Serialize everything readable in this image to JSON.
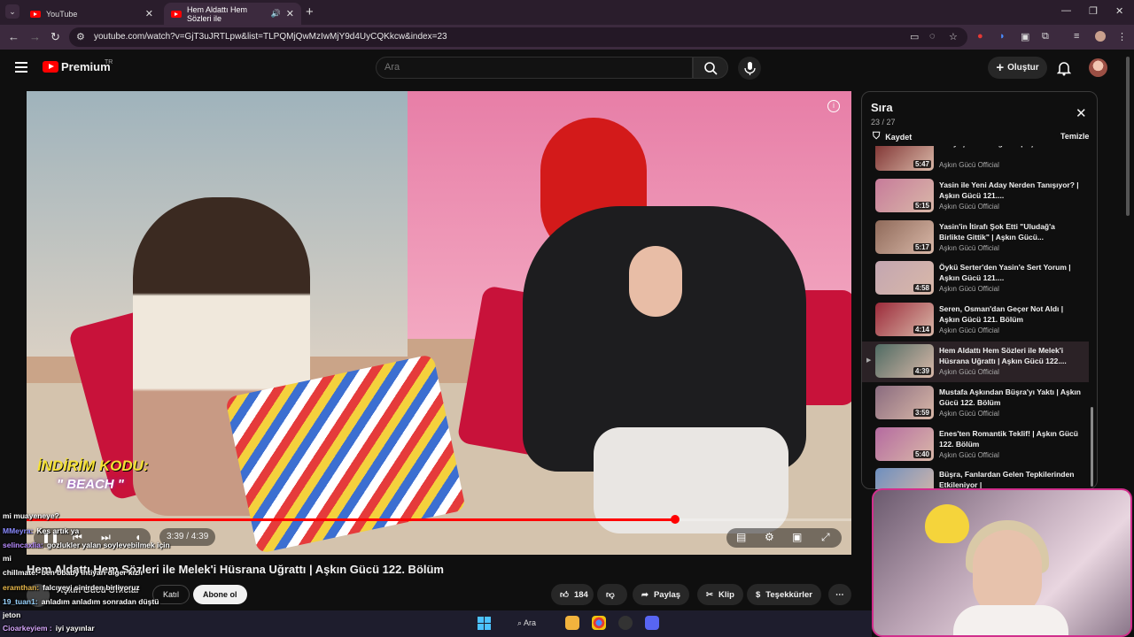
{
  "browser": {
    "tabs": [
      {
        "label": "YouTube"
      },
      {
        "label": "Hem Aldattı Hem Sözleri ile"
      }
    ],
    "url": "youtube.com/watch?v=GjT3uJRTLpw&list=TLPQMjQwMzIwMjY9d4UyCQKkcw&index=23"
  },
  "header": {
    "logo_text": "Premium",
    "logo_suffix": "TR",
    "search_placeholder": "Ara",
    "create_label": "Oluştur"
  },
  "video": {
    "title": "Hem Aldattı Hem Sözleri ile Melek'i Hüsrana Uğrattı | Aşkın Gücü 122. Bölüm",
    "time": "3:39 / 4:39",
    "progress_fraction": 0.786,
    "promo_label": "İNDİRİM KODU:",
    "promo_code": "\" BEACH \"",
    "channel": "Aşkın Gücü Official",
    "join_label": "Katıl",
    "subscribe_label": "Abone ol",
    "likes": "184",
    "share_label": "Paylaş",
    "clip_label": "Klip",
    "thanks_label": "Teşekkürler"
  },
  "playlist": {
    "title": "Sıra",
    "count": "23 / 27",
    "save_label": "Kaydet",
    "clear_label": "Temizle",
    "items": [
      {
        "title": "Gözyaşlarına Boğuldu | Aşkın...",
        "channel": "Aşkın Gücü Official",
        "duration": "5:47",
        "active": false
      },
      {
        "title": "Yasin ile Yeni Aday Nerden Tanışıyor? | Aşkın Gücü 121....",
        "channel": "Aşkın Gücü Official",
        "duration": "5:15",
        "active": false
      },
      {
        "title": "Yasin'in İtirafı Şok Etti \"Uludağ'a Birlikte Gittik\" | Aşkın Gücü...",
        "channel": "Aşkın Gücü Official",
        "duration": "5:17",
        "active": false
      },
      {
        "title": "Öykü Serter'den Yasin'e Sert Yorum | Aşkın Gücü 121....",
        "channel": "Aşkın Gücü Official",
        "duration": "4:58",
        "active": false
      },
      {
        "title": "Seren, Osman'dan Geçer Not Aldı | Aşkın Gücü 121. Bölüm",
        "channel": "Aşkın Gücü Official",
        "duration": "4:14",
        "active": false
      },
      {
        "title": "Hem Aldattı Hem Sözleri ile Melek'i Hüsrana Uğrattı | Aşkın Gücü 122....",
        "channel": "Aşkın Gücü Official",
        "duration": "4:39",
        "active": true
      },
      {
        "title": "Mustafa Aşkından Büşra'yı Yaktı | Aşkın Gücü 122. Bölüm",
        "channel": "Aşkın Gücü Official",
        "duration": "3:59",
        "active": false
      },
      {
        "title": "Enes'ten Romantik Teklif! | Aşkın Gücü 122. Bölüm",
        "channel": "Aşkın Gücü Official",
        "duration": "5:40",
        "active": false
      },
      {
        "title": "Büşra, Fanlardan Gelen Tepkilerinden Etkileniyor |",
        "channel": "",
        "duration": "",
        "active": false
      }
    ]
  },
  "chat": [
    {
      "user": "",
      "text": "mi muayeneye?",
      "color": "#ffffff"
    },
    {
      "user": "MMeyra:",
      "text": "Kes artık ya",
      "color": "#8a8aff"
    },
    {
      "user": "selincaxlia:",
      "text": "gozlukler yalan soylevebilmek için",
      "color": "#b88cff"
    },
    {
      "user": "",
      "text": "mi",
      "color": "#ffffff"
    },
    {
      "user": "chillmate:",
      "text": "ben bbaby ihtiyarı diger kız/ı",
      "color": "#ffffff"
    },
    {
      "user": "eramthan:",
      "text": "falcıyeyi sinirden birliyoruz",
      "color": "#e8b84a"
    },
    {
      "user": "19_tuan1:",
      "text": "anladım anladım sonradan düştü",
      "color": "#9ad5ff"
    },
    {
      "user": "",
      "text": "jeton",
      "color": "#ffffff"
    },
    {
      "user": "Cioarkeyiem :",
      "text": "iyi yayınlar",
      "color": "#d8a8ff"
    }
  ],
  "taskbar": {
    "search_label": "Ara"
  },
  "colors": {
    "accent": "#ff0000",
    "browser_frame": "#3c2a3e",
    "webcam_border": "#d12f8c"
  }
}
